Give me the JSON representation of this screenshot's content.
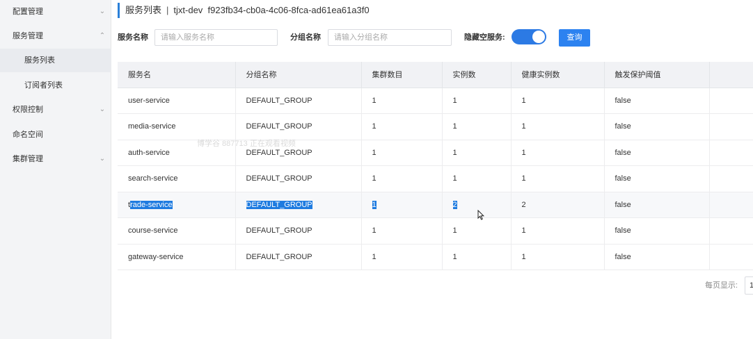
{
  "sidebar": {
    "items": [
      {
        "label": "配置管理",
        "expanded": false
      },
      {
        "label": "服务管理",
        "expanded": true
      },
      {
        "label": "服务列表",
        "active": true
      },
      {
        "label": "订阅者列表",
        "active": false
      },
      {
        "label": "权限控制",
        "expanded": false
      },
      {
        "label": "命名空间"
      },
      {
        "label": "集群管理",
        "expanded": false
      }
    ]
  },
  "header": {
    "title": "服务列表",
    "separator": "|",
    "namespace": "tjxt-dev",
    "namespace_id": "f923fb34-cb0a-4c06-8fca-ad61ea61a3f0"
  },
  "filters": {
    "service_name_label": "服务名称",
    "service_name_placeholder": "请输入服务名称",
    "group_name_label": "分组名称",
    "group_name_placeholder": "请输入分组名称",
    "hide_empty_label": "隐藏空服务:",
    "hide_empty_on": true,
    "query_label": "查询"
  },
  "table": {
    "columns": [
      "服务名",
      "分组名称",
      "集群数目",
      "实例数",
      "健康实例数",
      "触发保护阈值"
    ],
    "rows": [
      [
        "user-service",
        "DEFAULT_GROUP",
        "1",
        "1",
        "1",
        "false"
      ],
      [
        "media-service",
        "DEFAULT_GROUP",
        "1",
        "1",
        "1",
        "false"
      ],
      [
        "auth-service",
        "DEFAULT_GROUP",
        "1",
        "1",
        "1",
        "false"
      ],
      [
        "search-service",
        "DEFAULT_GROUP",
        "1",
        "1",
        "1",
        "false"
      ],
      [
        "trade-service",
        "DEFAULT_GROUP",
        "1",
        "2",
        "2",
        "false"
      ],
      [
        "course-service",
        "DEFAULT_GROUP",
        "1",
        "1",
        "1",
        "false"
      ],
      [
        "gateway-service",
        "DEFAULT_GROUP",
        "1",
        "1",
        "1",
        "false"
      ]
    ]
  },
  "pagination": {
    "page_size_label": "每页显示:",
    "page_size_value": "1"
  },
  "watermark": "博学谷 887713 正在观看视频",
  "colors": {
    "accent": "#2c82f0",
    "selection": "#1e7be0",
    "sidebar_bg": "#f3f4f6",
    "header_bg": "#f1f2f5"
  }
}
